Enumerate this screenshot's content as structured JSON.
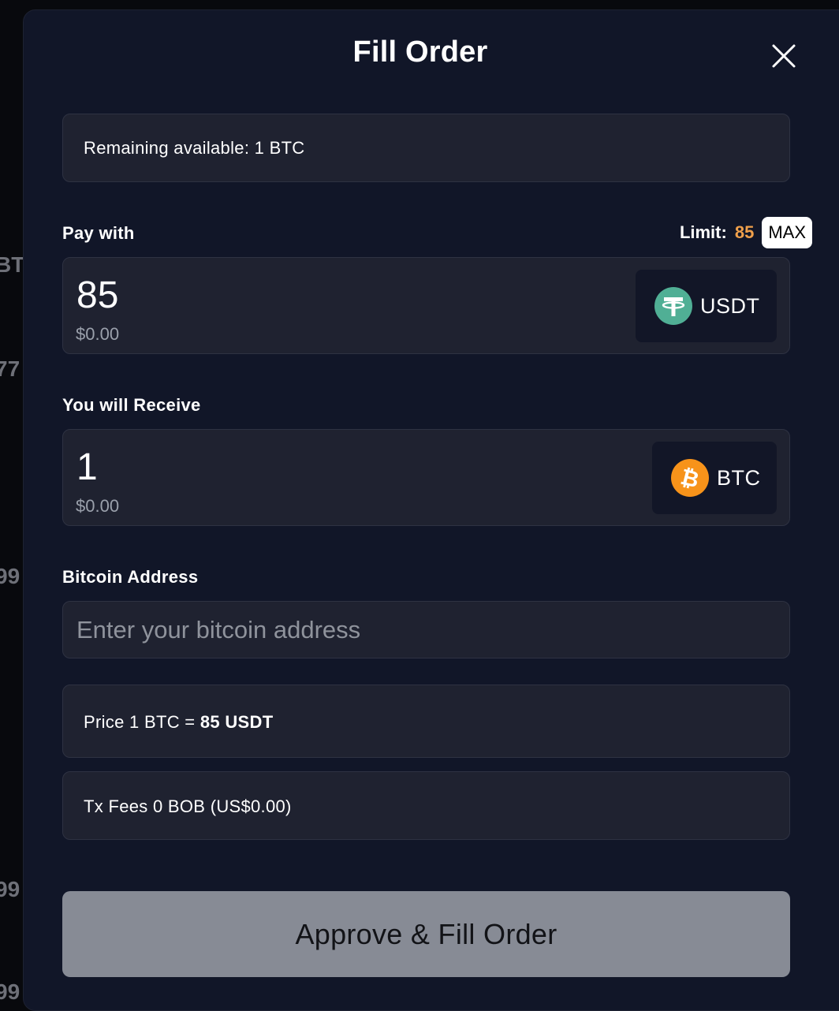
{
  "background": {
    "fragments": [
      "BTC",
      "77",
      "99",
      "99",
      "99"
    ]
  },
  "modal": {
    "title": "Fill Order",
    "close_icon": "close-icon"
  },
  "remaining": {
    "label": "Remaining available: 1 BTC"
  },
  "pay": {
    "label": "Pay with",
    "limit_label": "Limit:",
    "limit_value": "85",
    "max_label": "MAX",
    "amount": "85",
    "usd_value": "$0.00",
    "token": {
      "symbol": "USDT",
      "icon": "tether-icon",
      "color": "#50af95"
    }
  },
  "receive": {
    "label": "You will Receive",
    "amount": "1",
    "usd_value": "$0.00",
    "token": {
      "symbol": "BTC",
      "icon": "bitcoin-icon",
      "color": "#f7931a"
    }
  },
  "address": {
    "label": "Bitcoin Address",
    "value": "",
    "placeholder": "Enter your bitcoin address"
  },
  "price": {
    "prefix": "Price 1 BTC = ",
    "value": "85 USDT"
  },
  "fees": {
    "label": "Tx Fees 0 BOB (US$0.00)"
  },
  "submit": {
    "label": "Approve & Fill Order"
  },
  "colors": {
    "modal_bg": "#111628",
    "panel_bg": "#1f2230",
    "accent_orange": "#f0a04b",
    "button_disabled": "#878b95"
  }
}
